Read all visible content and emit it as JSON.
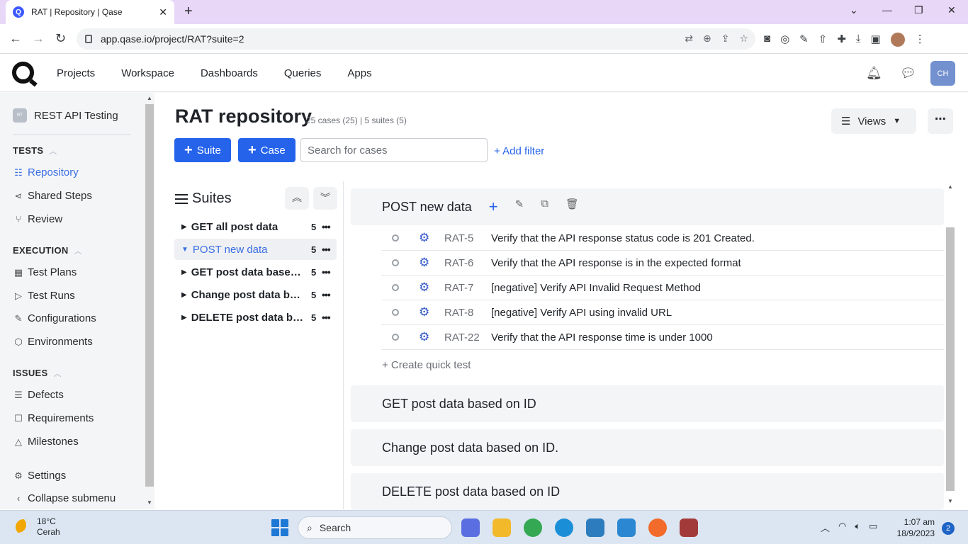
{
  "browser": {
    "tab_title": "RAT | Repository | Qase",
    "tab_close": "✕",
    "new_tab": "+",
    "url": "app.qase.io/project/RAT?suite=2",
    "window_controls": {
      "minimize": "—",
      "maximize": "❐",
      "close": "✕",
      "dropdown": "⌄"
    }
  },
  "app_nav": {
    "items": [
      "Projects",
      "Workspace",
      "Dashboards",
      "Queries",
      "Apps"
    ],
    "user_initials": "CH"
  },
  "sidebar": {
    "project_badge": "RT",
    "project_name": "REST API Testing",
    "sections": {
      "tests": "TESTS",
      "execution": "EXECUTION",
      "issues": "ISSUES"
    },
    "items": {
      "repository": "Repository",
      "shared_steps": "Shared Steps",
      "review": "Review",
      "test_plans": "Test Plans",
      "test_runs": "Test Runs",
      "configurations": "Configurations",
      "environments": "Environments",
      "defects": "Defects",
      "requirements": "Requirements",
      "milestones": "Milestones",
      "settings": "Settings",
      "collapse": "Collapse submenu"
    }
  },
  "page": {
    "title": "RAT repository",
    "subtitle": "25 cases (25) | 5 suites (5)",
    "views_label": "Views",
    "suite_button": "Suite",
    "case_button": "Case",
    "search_placeholder": "Search for cases",
    "add_filter": "+ Add filter"
  },
  "suites_panel": {
    "title": "Suites",
    "suites": [
      {
        "name": "GET all post data",
        "count": "5"
      },
      {
        "name": "POST new data",
        "count": "5"
      },
      {
        "name": "GET post data based on ID",
        "count": "5"
      },
      {
        "name": "Change post data based on ID.",
        "count": "5"
      },
      {
        "name": "DELETE post data based on ID",
        "count": "5"
      }
    ]
  },
  "cases_panel": {
    "open_suite": "POST new data",
    "cases": [
      {
        "id": "RAT-5",
        "title": "Verify that the API response status code is 201 Created."
      },
      {
        "id": "RAT-6",
        "title": "Verify that the API response is in the expected format"
      },
      {
        "id": "RAT-7",
        "title": "[negative] Verify API Invalid Request Method"
      },
      {
        "id": "RAT-8",
        "title": "[negative] Verify API using invalid URL"
      },
      {
        "id": "RAT-22",
        "title": "Verify that the API response time is under 1000"
      }
    ],
    "quick_create": "+ Create quick test",
    "collapsed_suites": [
      "GET post data based on ID",
      "Change post data based on ID.",
      "DELETE post data based on ID"
    ]
  },
  "taskbar": {
    "temperature": "18°C",
    "weather": "Cerah",
    "search": "Search",
    "time": "1:07 am",
    "date": "18/9/2023",
    "notifications": "2"
  },
  "colors": {
    "primary": "#2563eb",
    "active_link": "#3a6fe4",
    "tab_strip": "#e9d7f7",
    "avatar": "#7390cf"
  }
}
